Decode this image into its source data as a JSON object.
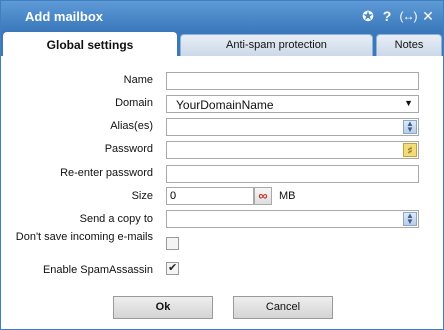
{
  "window": {
    "title": "Add mailbox"
  },
  "titlebar": {
    "pin_icon": "✪",
    "help": "?",
    "maximize": "(↔)",
    "close": "✕"
  },
  "tabs": [
    {
      "label": "Global settings",
      "active": true
    },
    {
      "label": "Anti-spam protection",
      "active": false
    },
    {
      "label": "Notes",
      "active": false
    }
  ],
  "form": {
    "name": {
      "label": "Name",
      "value": ""
    },
    "domain": {
      "label": "Domain",
      "value": "YourDomainName"
    },
    "aliases": {
      "label": "Alias(es)",
      "value": ""
    },
    "password": {
      "label": "Password",
      "value": ""
    },
    "reenter_password": {
      "label": "Re-enter password",
      "value": ""
    },
    "size": {
      "label": "Size",
      "value": "0",
      "unit": "MB",
      "infinite_symbol": "∞"
    },
    "send_copy": {
      "label": "Send a copy to",
      "value": ""
    },
    "dont_save": {
      "label": "Don't save incoming e-mails",
      "checked": false
    },
    "spamassassin": {
      "label": "Enable SpamAssassin",
      "checked": true
    }
  },
  "buttons": {
    "ok": "Ok",
    "cancel": "Cancel"
  },
  "icons": {
    "spin": "spin-icon",
    "key": "key-icon",
    "dropdown": "dropdown-arrow-icon"
  }
}
